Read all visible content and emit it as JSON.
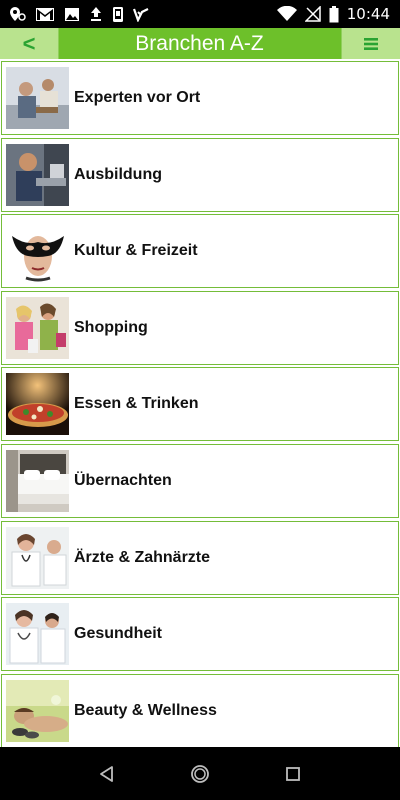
{
  "status_bar": {
    "time": "10:44",
    "left_icons": [
      "location-pin-icon",
      "gmail-icon",
      "image-icon",
      "upload-icon",
      "phone-icon",
      "check-icon"
    ],
    "right_icons": [
      "wifi-icon",
      "no-signal-icon",
      "battery-icon"
    ]
  },
  "app_bar": {
    "title": "Branchen A-Z",
    "back_label": "<",
    "menu_label": "≡"
  },
  "categories": [
    {
      "label": "Experten vor Ort",
      "icon": "experts-thumbnail"
    },
    {
      "label": "Ausbildung",
      "icon": "apprentice-thumbnail"
    },
    {
      "label": "Kultur & Freizeit",
      "icon": "mask-thumbnail"
    },
    {
      "label": "Shopping",
      "icon": "shopping-thumbnail"
    },
    {
      "label": "Essen & Trinken",
      "icon": "pizza-thumbnail"
    },
    {
      "label": "Übernachten",
      "icon": "hotel-bed-thumbnail"
    },
    {
      "label": "Ärzte & Zahnärzte",
      "icon": "doctor-thumbnail"
    },
    {
      "label": "Gesundheit",
      "icon": "medical-team-thumbnail"
    },
    {
      "label": "Beauty & Wellness",
      "icon": "spa-thumbnail"
    }
  ],
  "nav_bar": {
    "buttons": [
      "back-triangle-icon",
      "home-circle-icon",
      "recents-square-icon"
    ]
  },
  "colors": {
    "accent": "#6dc02a",
    "nav_button_bg": "#b9e38e",
    "nav_button_fg": "#2aa332",
    "item_border": "#74bd39"
  }
}
